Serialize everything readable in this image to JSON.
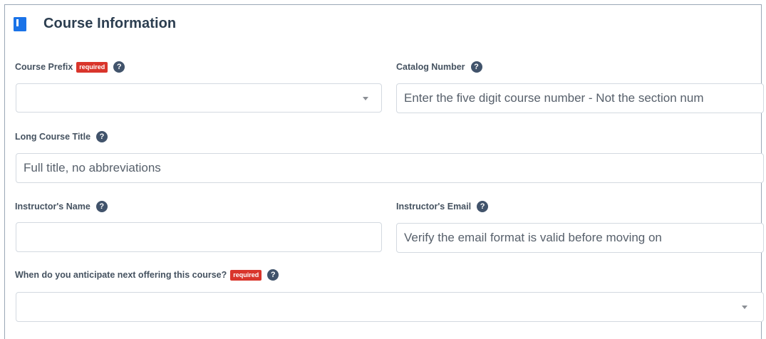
{
  "header": {
    "title": "Course Information",
    "icon": "book-icon",
    "accent": "#1a73e8"
  },
  "form": {
    "required_badge": "required",
    "help_glyph": "?",
    "course_prefix": {
      "label": "Course Prefix",
      "value": ""
    },
    "catalog_number": {
      "label": "Catalog Number",
      "placeholder": "Enter the five digit course number - Not the section num"
    },
    "long_title": {
      "label": "Long Course Title",
      "placeholder": "Full title, no abbreviations"
    },
    "instructor_name": {
      "label": "Instructor's Name",
      "value": ""
    },
    "instructor_email": {
      "label": "Instructor's Email",
      "placeholder": "Verify the email format is valid before moving on"
    },
    "next_offering": {
      "label": "When do you anticipate next offering this course?",
      "value": ""
    }
  },
  "colors": {
    "required_badge": "#d9352b",
    "help_icon": "#41536b",
    "label_text": "#455260"
  }
}
